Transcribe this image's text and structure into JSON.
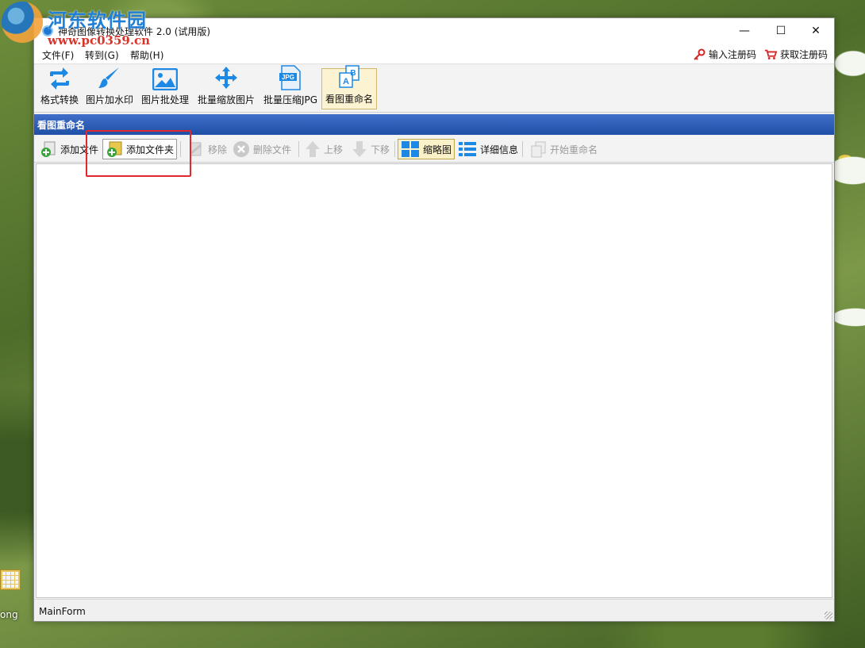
{
  "watermark": {
    "site_name": "河东软件园",
    "url": "www.pc0359.cn"
  },
  "desktop": {
    "icon_label": "ong"
  },
  "window": {
    "title": "神奇图像转换处理软件 2.0 (试用版)",
    "controls": {
      "minimize": "—",
      "maximize": "☐",
      "close": "✕"
    }
  },
  "menu": {
    "items": [
      "文件(F)",
      "转到(G)",
      "帮助(H)"
    ],
    "enter_code": "输入注册码",
    "get_code": "获取注册码"
  },
  "toolbar": {
    "tools": [
      {
        "label": "格式转换",
        "icon": "convert-icon"
      },
      {
        "label": "图片加水印",
        "icon": "brush-icon"
      },
      {
        "label": "图片批处理",
        "icon": "image-icon"
      },
      {
        "label": "批量缩放图片",
        "icon": "move-arrows-icon"
      },
      {
        "label": "批量压缩JPG",
        "icon": "jpg-file-icon"
      },
      {
        "label": "看图重命名",
        "icon": "rename-icon",
        "active": true
      }
    ]
  },
  "section": {
    "title": "看图重命名"
  },
  "subtoolbar": {
    "add_file": "添加文件",
    "add_folder": "添加文件夹",
    "remove": "移除",
    "delete_file": "删除文件",
    "move_up": "上移",
    "move_down": "下移",
    "thumbnail": "缩略图",
    "details": "详细信息",
    "start_rename": "开始重命名"
  },
  "status": {
    "text": "MainForm"
  },
  "colors": {
    "accent_blue": "#1e88e5",
    "header_blue": "#1f4fa6",
    "highlight_red": "#e0282d"
  }
}
